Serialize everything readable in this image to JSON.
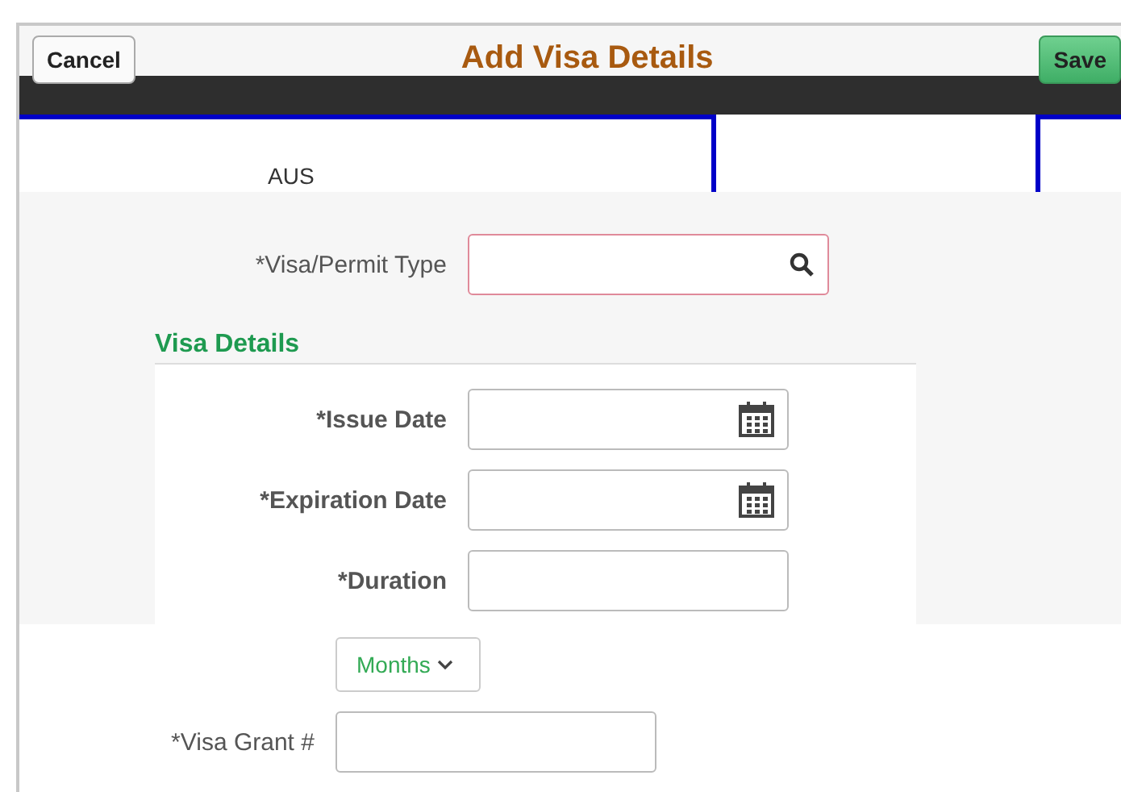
{
  "header": {
    "cancel": "Cancel",
    "title": "Add Visa Details",
    "save": "Save"
  },
  "background": {
    "value": "AUS"
  },
  "visa_type": {
    "label": "*Visa/Permit Type"
  },
  "section": {
    "title": "Visa Details"
  },
  "fields": [
    {
      "label": "*Issue Date",
      "kind": "date"
    },
    {
      "label": "*Expiration Date",
      "kind": "date"
    },
    {
      "label": "*Duration",
      "kind": "text"
    }
  ],
  "unit": {
    "value": "Months"
  },
  "grant": {
    "label": "*Visa Grant #"
  }
}
